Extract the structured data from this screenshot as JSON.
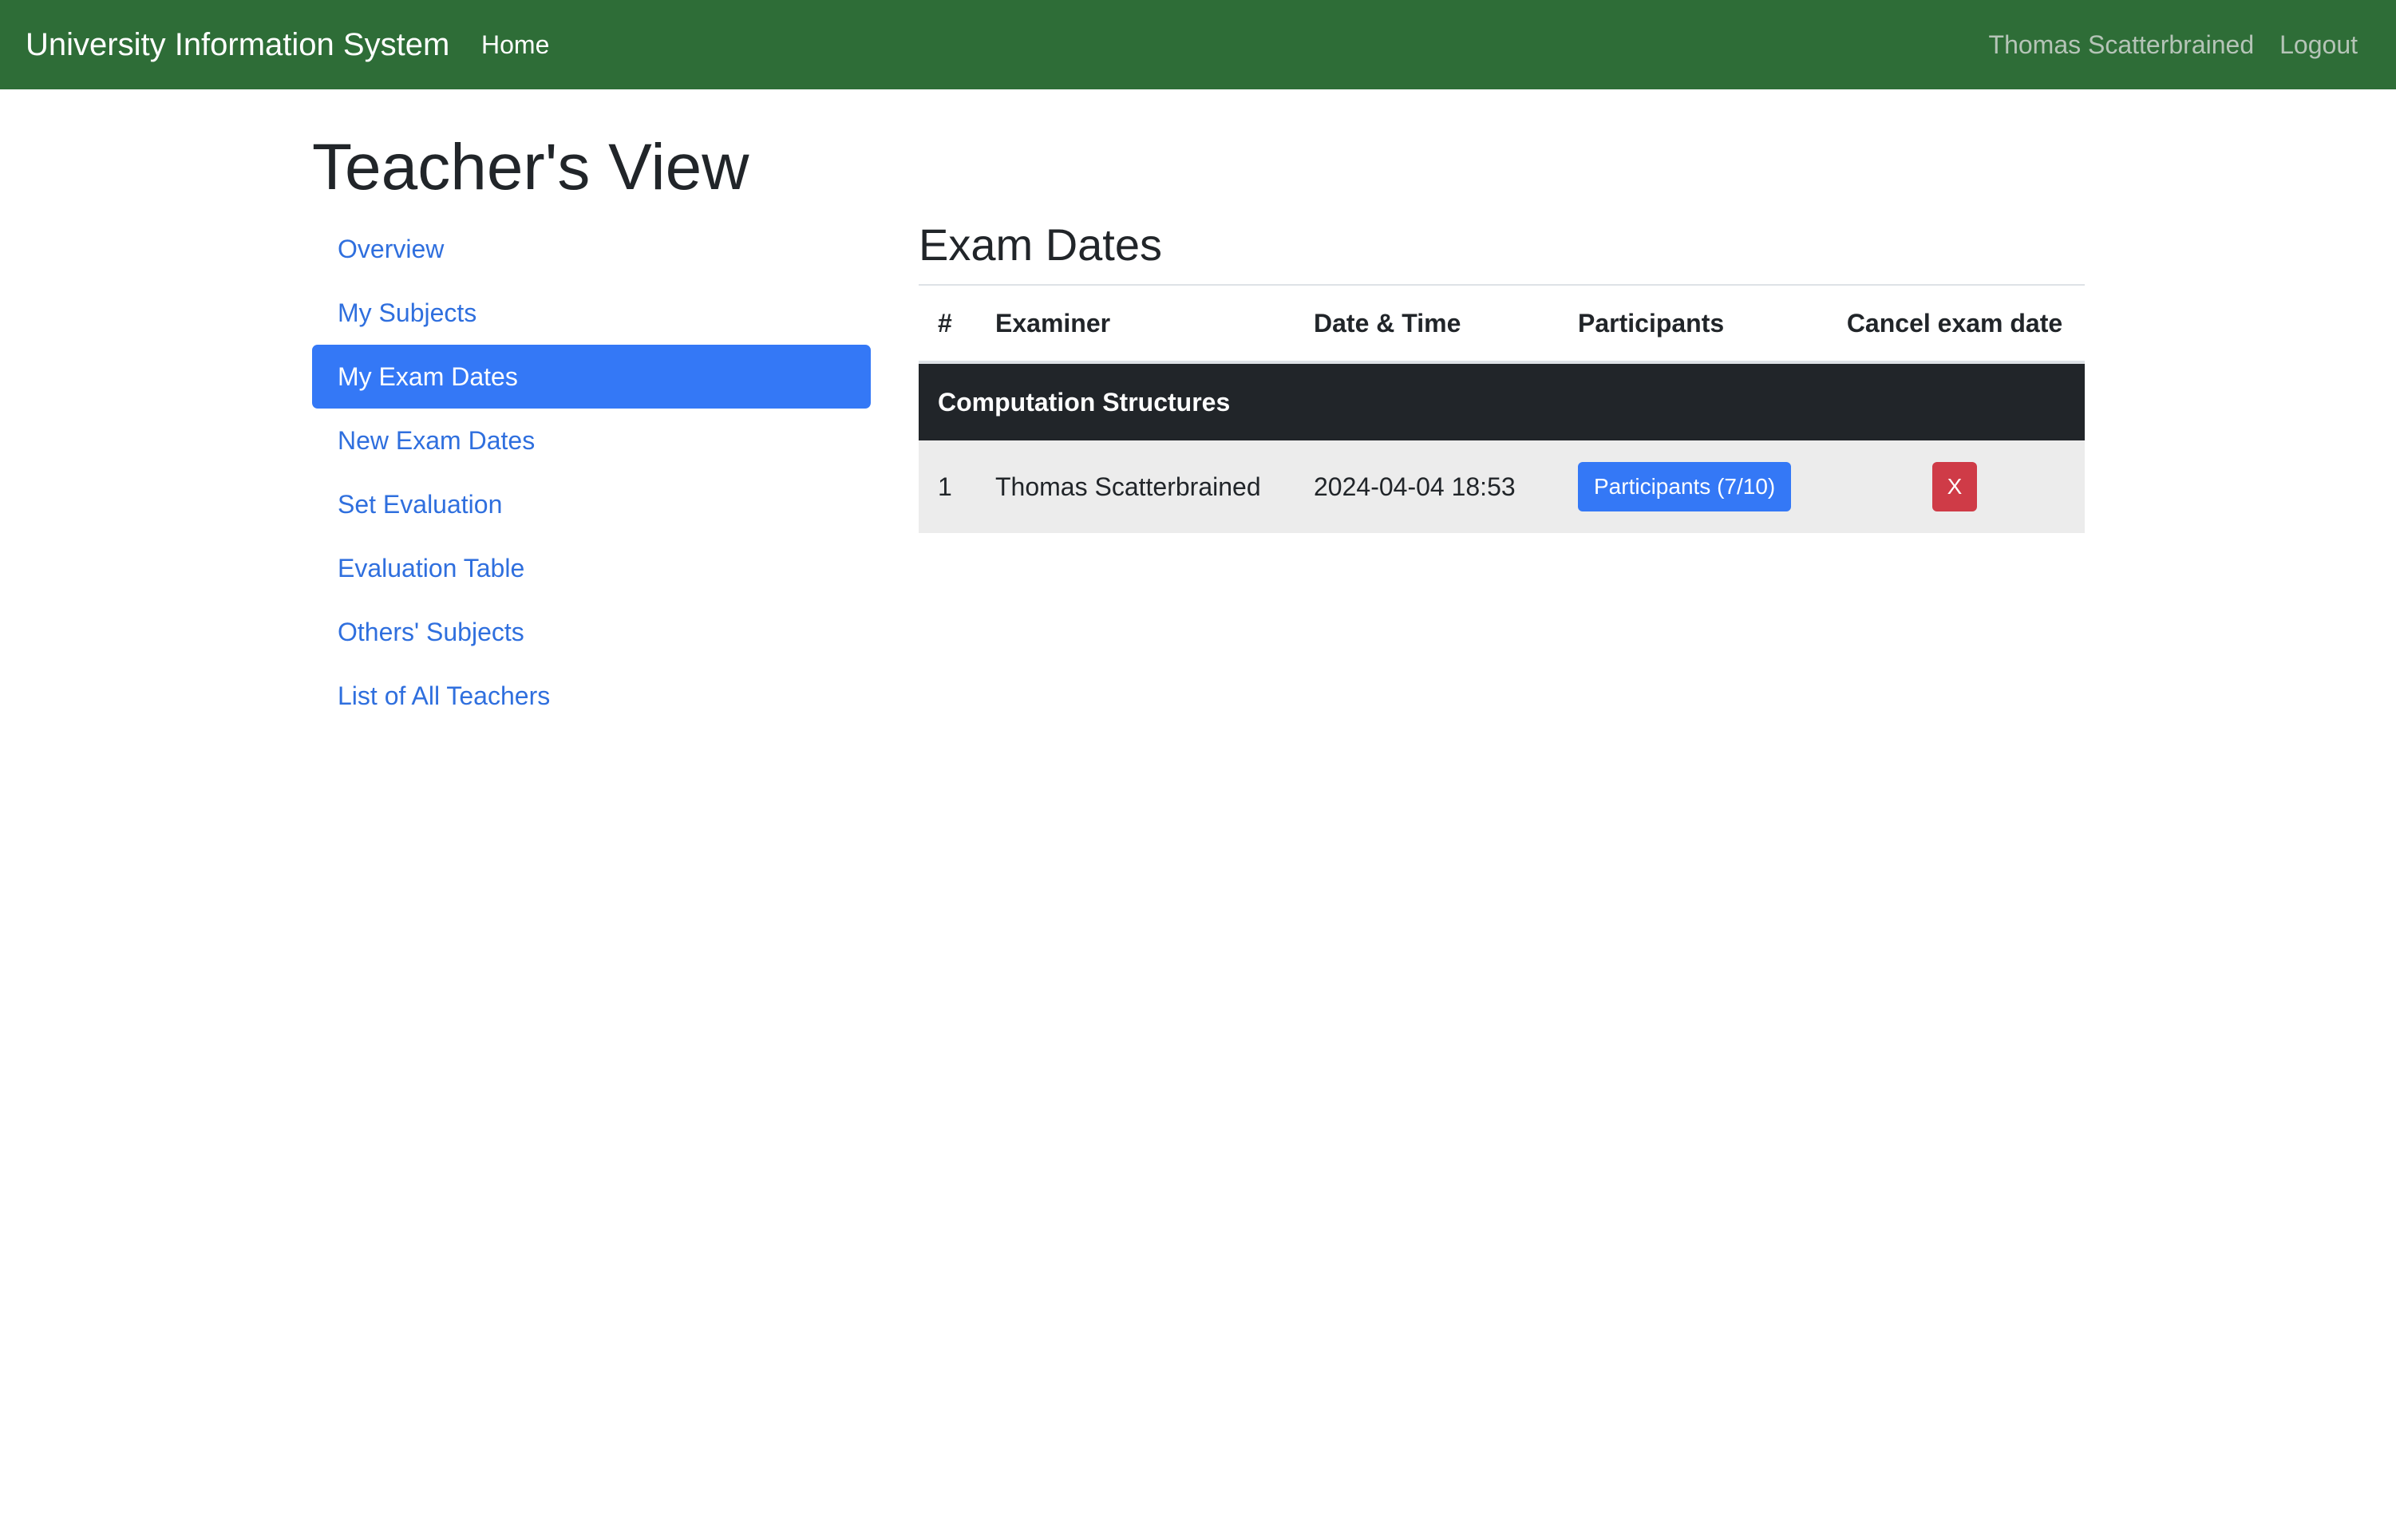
{
  "navbar": {
    "brand": "University Information System",
    "home": "Home",
    "user_name": "Thomas Scatterbrained",
    "logout": "Logout"
  },
  "page": {
    "title": "Teacher's View"
  },
  "sidebar": {
    "items": [
      {
        "label": "Overview",
        "active": false
      },
      {
        "label": "My Subjects",
        "active": false
      },
      {
        "label": "My Exam Dates",
        "active": true
      },
      {
        "label": "New Exam Dates",
        "active": false
      },
      {
        "label": "Set Evaluation",
        "active": false
      },
      {
        "label": "Evaluation Table",
        "active": false
      },
      {
        "label": "Others' Subjects",
        "active": false
      },
      {
        "label": "List of All Teachers",
        "active": false
      }
    ]
  },
  "main": {
    "title": "Exam Dates",
    "table": {
      "headers": [
        "#",
        "Examiner",
        "Date & Time",
        "Participants",
        "Cancel exam date"
      ],
      "groups": [
        {
          "subject": "Computation Structures",
          "rows": [
            {
              "index": "1",
              "examiner": "Thomas Scatterbrained",
              "datetime": "2024-04-04 18:53",
              "participants_label": "Participants (7/10)",
              "cancel_label": "X"
            }
          ]
        }
      ]
    }
  },
  "colors": {
    "navbar_bg": "#2e6d37",
    "accent": "#3478f6",
    "danger": "#cf3b47",
    "group_row_bg": "#212529",
    "data_row_bg": "#ececec"
  }
}
